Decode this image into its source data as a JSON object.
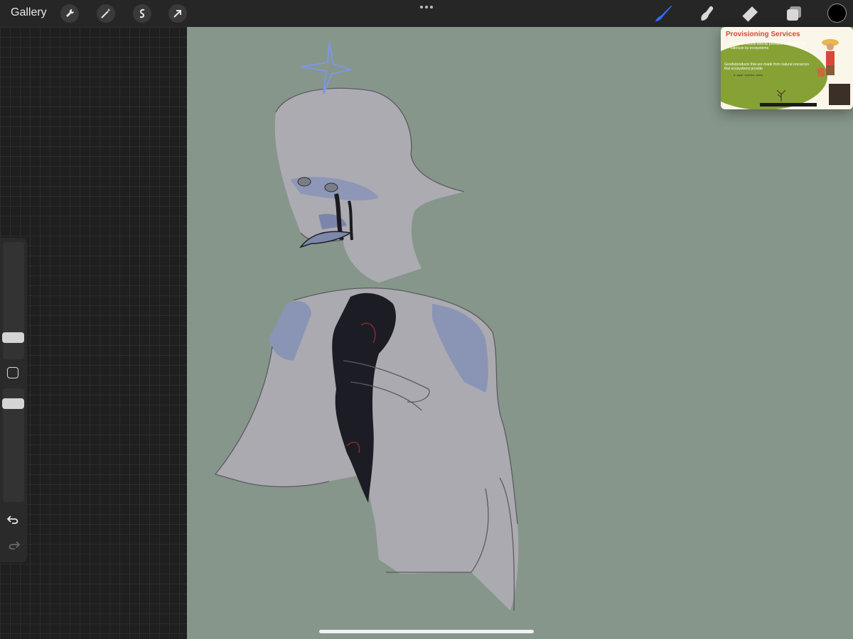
{
  "toolbar": {
    "gallery_label": "Gallery",
    "left_tools": [
      {
        "name": "wrench-icon"
      },
      {
        "name": "magic-wand-icon"
      },
      {
        "name": "selection-icon"
      },
      {
        "name": "transform-arrow-icon"
      }
    ],
    "right_tools": [
      {
        "name": "brush-icon",
        "active": true,
        "color": "#2f6fff"
      },
      {
        "name": "smudge-icon"
      },
      {
        "name": "eraser-icon"
      },
      {
        "name": "layers-icon"
      }
    ],
    "current_color": "#000000"
  },
  "canvas": {
    "background_color": "#86968a"
  },
  "side_panel": {
    "brush_size_slider": "brush-size-slider",
    "opacity_slider": "opacity-slider",
    "undo": "undo-icon",
    "redo": "redo-icon"
  },
  "pip_video": {
    "title": "Provisioning Services",
    "line1": "Goods/products directly provided to humans for sale/use by ecosystems",
    "line2": "Goods/products that are made from natural resources that ecosystems provide",
    "note": "ie. paper, medicine, rubber"
  }
}
